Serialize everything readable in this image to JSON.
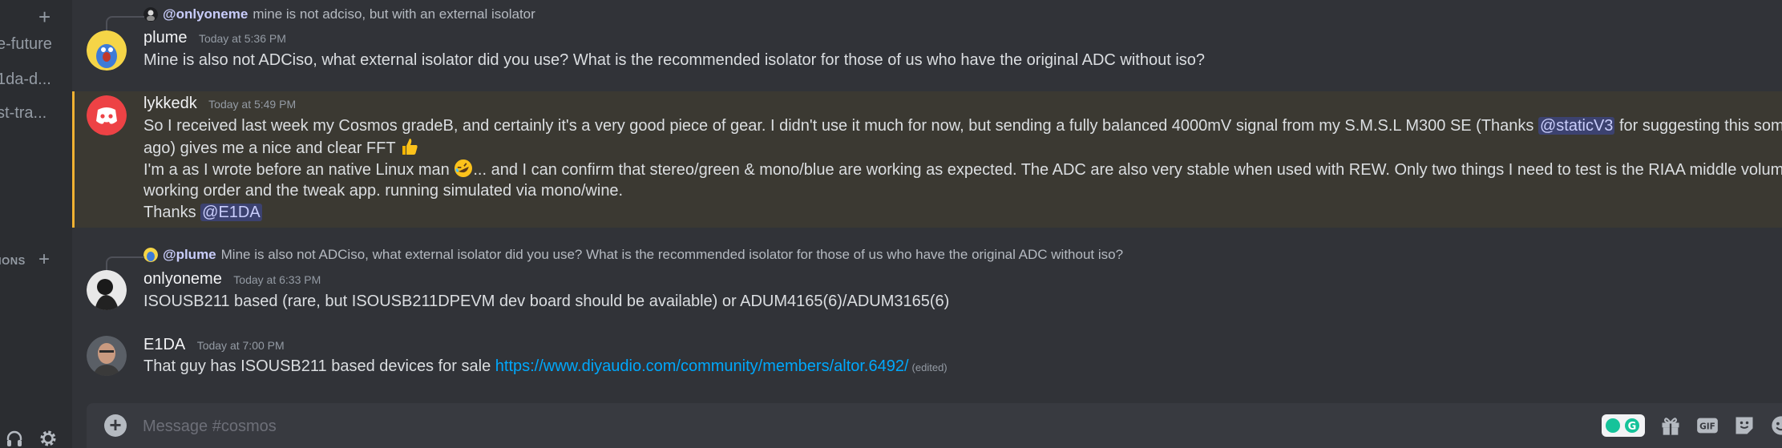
{
  "sidebar": {
    "channels": [
      "e-future",
      "1da-d...",
      "st-tra..."
    ],
    "category_label": "IONS"
  },
  "messages": [
    {
      "reply_to_user": "@onlyoneme",
      "reply_excerpt": "mine is not adciso, but with an external isolator",
      "author": "plume",
      "timestamp": "Today at 5:36 PM",
      "text": "Mine is also not ADCiso, what external isolator did you use? What is the recommended isolator for those of us who have the original ADC without iso?"
    },
    {
      "author": "lykkedk",
      "timestamp": "Today at 5:49 PM",
      "line1_a": "So I received last week my Cosmos gradeB, and certainly it's a very good piece of gear. I  didn't use it much for now, but sending a fully balanced 4000mV signal from my S.M.S.L M300 SE (Thanks ",
      "line1_mention": "@staticV3",
      "line1_b": " for suggesting this some time",
      "line2": "ago) gives me a nice and clear FFT",
      "line3_a": "I'm a as I wrote before an native Linux man ",
      "line3_b": "... and I can confirm that stereo/green & mono/blue are working as expected. The ADC are also very stable when used with REW. Only two things I need to test is the RIAA middle volume good",
      "line4": "working order and the tweak app. running simulated via mono/wine.",
      "line5_a": "Thanks ",
      "line5_mention": "@E1DA"
    },
    {
      "reply_to_user": "@plume",
      "reply_excerpt": "Mine is also not ADCiso, what external isolator did you use? What is the recommended isolator for those of us who have the original ADC without iso?",
      "author": "onlyoneme",
      "timestamp": "Today at 6:33 PM",
      "text": "ISOUSB211 based (rare, but ISOUSB211DPEVM dev board should be available) or ADUM4165(6)/ADUM3165(6)"
    },
    {
      "author": "E1DA",
      "timestamp": "Today at 7:00 PM",
      "text_a": "That guy has ISOUSB211 based devices for sale ",
      "link": "https://www.diyaudio.com/community/members/altor.6492/",
      "edited": "(edited)"
    }
  ],
  "composer": {
    "placeholder": "Message #cosmos"
  },
  "icons": [
    "plus-icon",
    "gear-icon",
    "headset-icon",
    "add-attachment-icon",
    "gift-icon",
    "gif-icon",
    "sticker-icon",
    "emoji-icon",
    "grammarly-icon",
    "thumbs-up-emoji",
    "rofl-emoji",
    "discord-logo"
  ],
  "colors": {
    "background": "#313338",
    "sidebar": "#2b2d31",
    "highlight": "#3b3932",
    "highlight_border": "#f0b232",
    "mention_bg": "#3c4270",
    "link": "#00a8fc"
  }
}
